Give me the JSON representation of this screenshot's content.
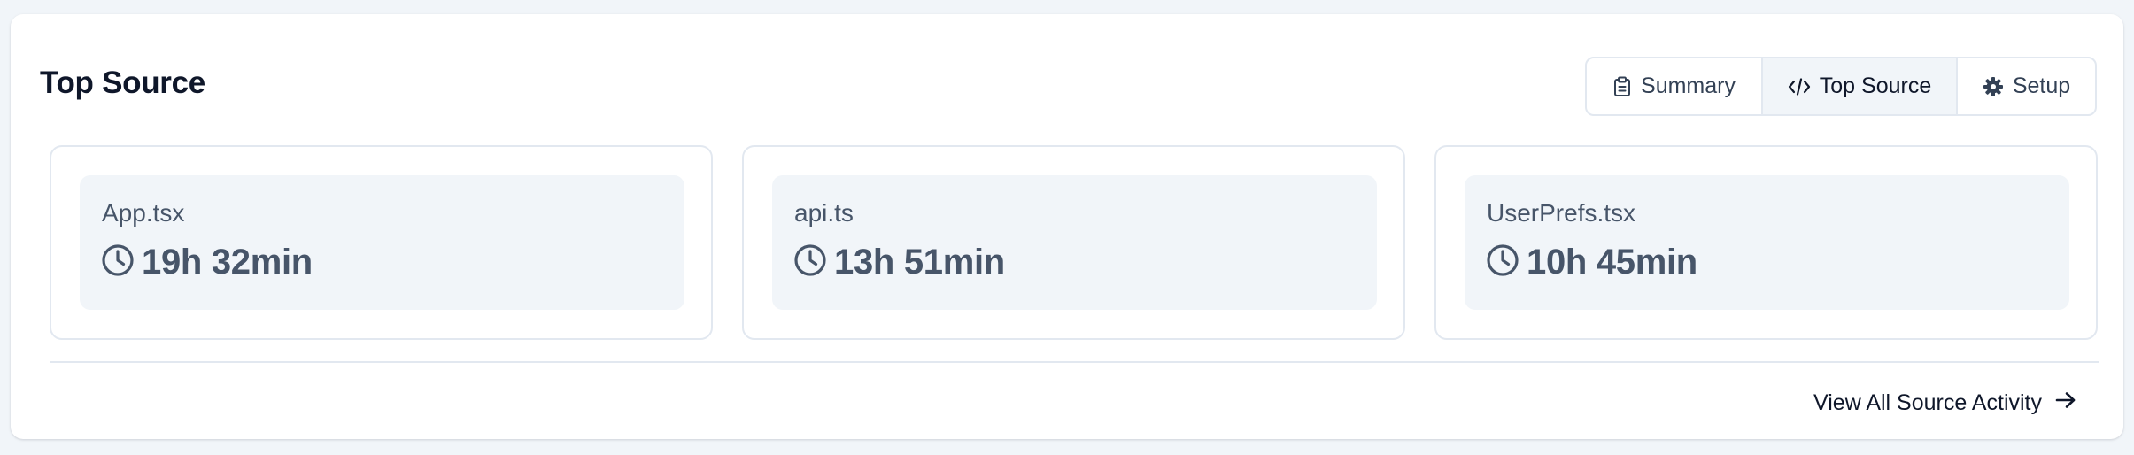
{
  "header": {
    "title": "Top Source"
  },
  "tabs": [
    {
      "label": "Summary",
      "icon": "clipboard-icon",
      "active": false
    },
    {
      "label": "Top Source",
      "icon": "code-icon",
      "active": true
    },
    {
      "label": "Setup",
      "icon": "gear-icon",
      "active": false
    }
  ],
  "sources": [
    {
      "file": "App.tsx",
      "duration": "19h 32min",
      "icon": "clock-icon"
    },
    {
      "file": "api.ts",
      "duration": "13h 51min",
      "icon": "clock-icon"
    },
    {
      "file": "UserPrefs.tsx",
      "duration": "10h 45min",
      "icon": "clock-icon"
    }
  ],
  "footer": {
    "view_all_label": "View All Source Activity",
    "icon": "arrow-right-icon"
  },
  "colors": {
    "page_background": "#f1f5f9",
    "card_background": "#ffffff",
    "border": "#e2e8f0",
    "tile_background": "#f1f5f9",
    "text_primary": "#0f172a",
    "text_muted": "#475569"
  }
}
